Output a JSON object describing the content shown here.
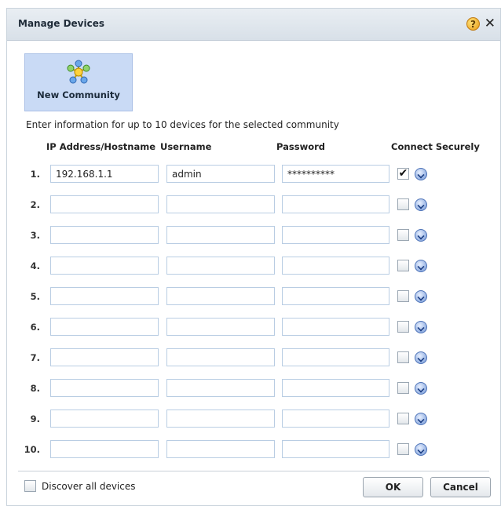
{
  "dialog": {
    "title": "Manage Devices",
    "help_icon": "help-icon",
    "close_icon": "close-icon"
  },
  "community": {
    "label": "New Community",
    "icon": "network-icon"
  },
  "instructions": "Enter information for up to 10 devices for the selected community",
  "columns": {
    "ip": "IP Address/Hostname",
    "username": "Username",
    "password": "Password",
    "secure": "Connect Securely"
  },
  "devices": [
    {
      "num": "1.",
      "ip": "192.168.1.1",
      "username": "admin",
      "password": "**********",
      "secure": true
    },
    {
      "num": "2.",
      "ip": "",
      "username": "",
      "password": "",
      "secure": false
    },
    {
      "num": "3.",
      "ip": "",
      "username": "",
      "password": "",
      "secure": false
    },
    {
      "num": "4.",
      "ip": "",
      "username": "",
      "password": "",
      "secure": false
    },
    {
      "num": "5.",
      "ip": "",
      "username": "",
      "password": "",
      "secure": false
    },
    {
      "num": "6.",
      "ip": "",
      "username": "",
      "password": "",
      "secure": false
    },
    {
      "num": "7.",
      "ip": "",
      "username": "",
      "password": "",
      "secure": false
    },
    {
      "num": "8.",
      "ip": "",
      "username": "",
      "password": "",
      "secure": false
    },
    {
      "num": "9.",
      "ip": "",
      "username": "",
      "password": "",
      "secure": false
    },
    {
      "num": "10.",
      "ip": "",
      "username": "",
      "password": "",
      "secure": false
    }
  ],
  "footer": {
    "discover_label": "Discover all devices",
    "discover_checked": false,
    "ok_label": "OK",
    "cancel_label": "Cancel"
  },
  "colors": {
    "title_bar": "#dfe6ed",
    "community_tile": "#c9daf5",
    "field_border": "#b9cde3",
    "dropdown_accent": "#4f74b8"
  }
}
